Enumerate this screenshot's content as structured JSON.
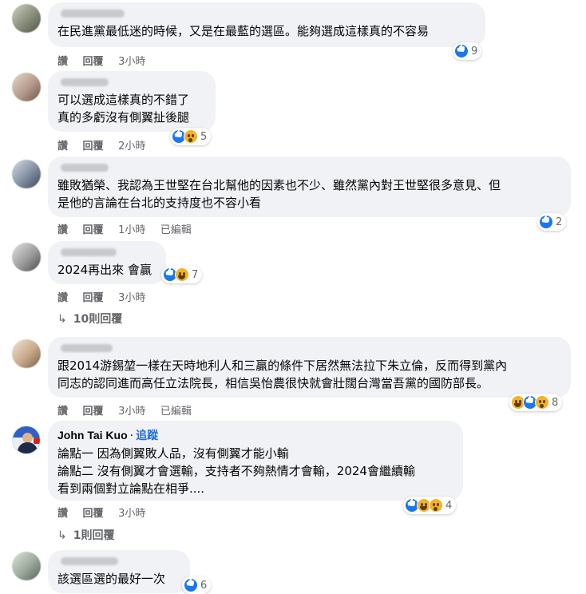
{
  "actions": {
    "like": "讚",
    "reply": "回覆",
    "edited": "已編輯"
  },
  "comments": [
    {
      "author": "",
      "text": [
        "在民進黨最低迷的時候，又是在最藍的選區。能夠選成這樣真的不容易"
      ],
      "time": "3小時",
      "reactions": [
        "like"
      ],
      "count": "9"
    },
    {
      "author": "",
      "text": [
        "可以選成這樣真的不錯了",
        "真的多虧沒有側翼扯後腿"
      ],
      "time": "2小時",
      "reactions": [
        "like",
        "wow"
      ],
      "count": "5"
    },
    {
      "author": "",
      "text": [
        "雖敗猶榮、我認為王世堅在台北幫他的因素也不少、雖然黨內對王世堅很多意見、但",
        "是他的言論在台北的支持度也不容小看"
      ],
      "time": "1小時",
      "edited": true,
      "reactions": [
        "like"
      ],
      "count": "2"
    },
    {
      "author": "",
      "text": [
        "2024再出來 會贏"
      ],
      "time": "3小時",
      "reactions": [
        "like",
        "haha"
      ],
      "count": "7",
      "replies": "10則回覆"
    },
    {
      "author": "",
      "text": [
        "跟2014游錫堃一樣在天時地利人和三贏的條件下居然無法拉下朱立倫，反而得到黨內",
        "同志的認同進而高任立法院長，相信吳怡農很快就會壯闊台灣當吾黨的國防部長。"
      ],
      "time": "3小時",
      "edited": true,
      "reactions": [
        "haha",
        "like",
        "wow"
      ],
      "count": "8"
    },
    {
      "author": "John Tai Kuo",
      "follow": "追蹤",
      "text": [
        "論點一 因為側翼敗人品，沒有側翼才能小輸",
        "論點二 沒有側翼才會選輸，支持者不夠熱情才會輸，2024會繼續輸",
        "看到兩個對立論點在相爭...."
      ],
      "time": "3小時",
      "reactions": [
        "like",
        "haha",
        "wow"
      ],
      "count": "4",
      "replies": "1則回覆"
    },
    {
      "author": "",
      "text": [
        "該選區選的最好一次"
      ],
      "reactions": [
        "like"
      ],
      "count": "6"
    }
  ]
}
